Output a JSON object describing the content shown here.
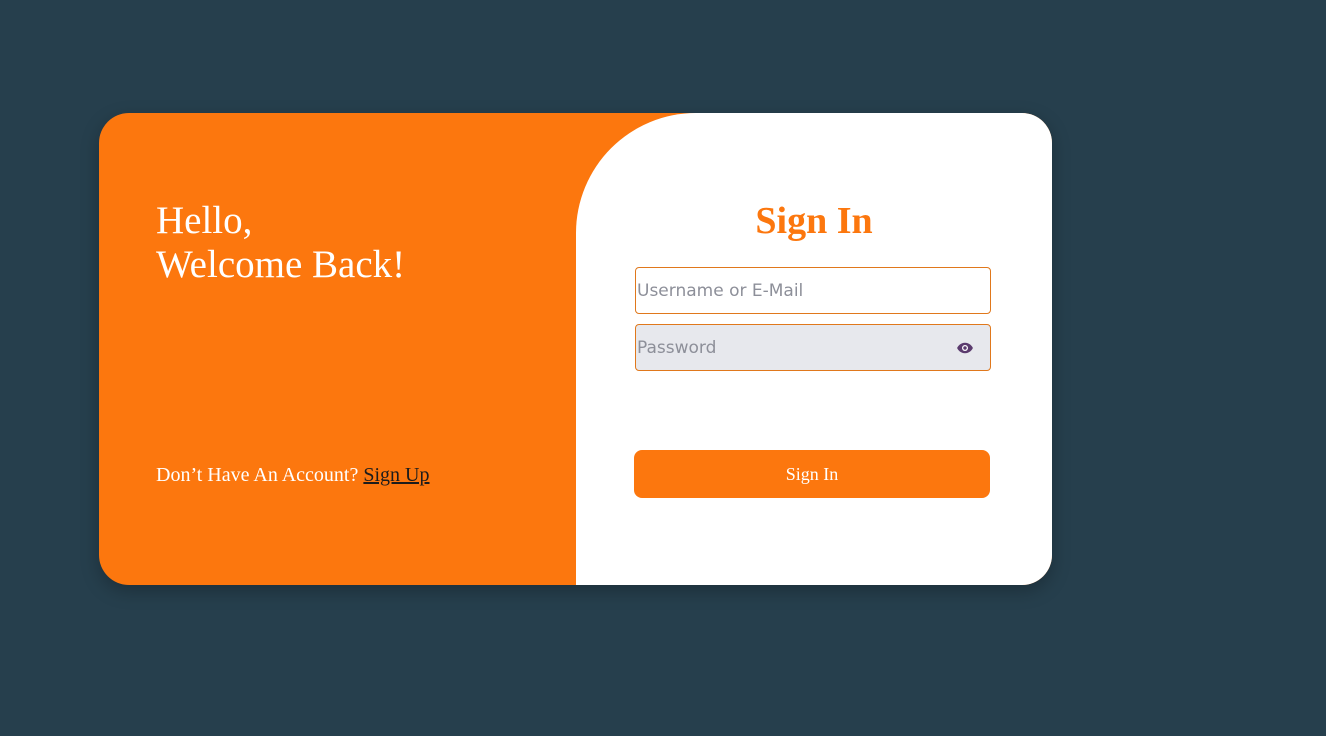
{
  "welcome": {
    "line1": "Hello,",
    "line2": "Welcome Back!",
    "account_prompt": "Don’t Have An Account?",
    "signup_label": "Sign Up"
  },
  "signin": {
    "title": "Sign In",
    "username_placeholder": "Username or E-Mail",
    "username_value": "",
    "password_placeholder": "Password",
    "password_value": "",
    "password_toggle_icon": "eye-icon",
    "submit_label": "Sign In"
  },
  "colors": {
    "background": "#263f4d",
    "accent": "#fc770e",
    "panel": "#ffffff",
    "password_field_bg": "#e7e8ed",
    "eye_icon": "#5b3b6e"
  }
}
